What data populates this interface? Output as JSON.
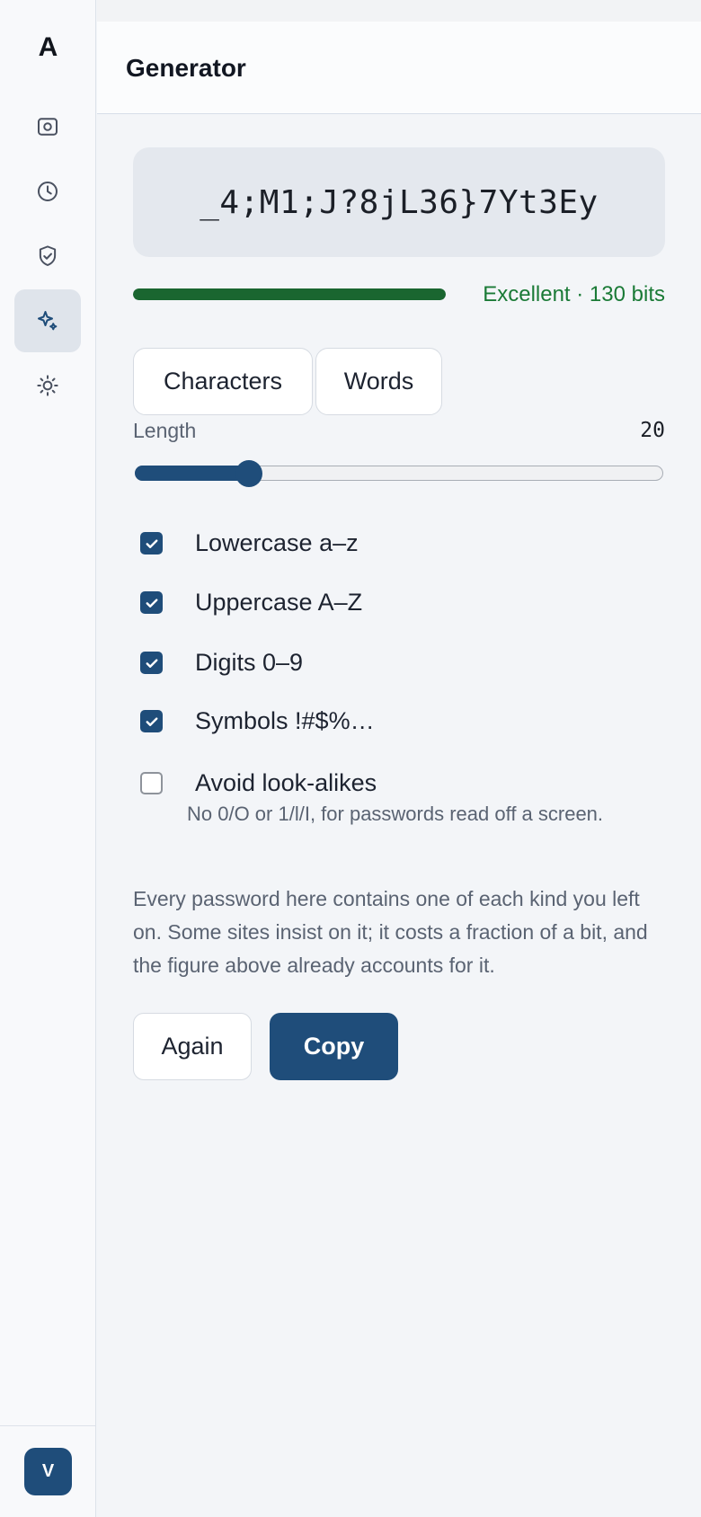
{
  "app": {
    "logo": "A",
    "user_initial": "V"
  },
  "sidebar": {
    "items": [
      {
        "icon": "vault-icon",
        "active": false
      },
      {
        "icon": "clock-icon",
        "active": false
      },
      {
        "icon": "shield-check-icon",
        "active": false
      },
      {
        "icon": "sparkles-icon",
        "active": true
      },
      {
        "icon": "sun-icon",
        "active": false
      }
    ]
  },
  "header": {
    "title": "Generator"
  },
  "generator": {
    "password": "_4;M1;J?8jL36}7Yt3Ey",
    "strength": {
      "label": "Excellent · 130 bits",
      "fill_fraction": 1.0,
      "color": "#1a6630"
    },
    "modes": [
      {
        "label": "Characters",
        "selected": true
      },
      {
        "label": "Words",
        "selected": false
      }
    ],
    "length": {
      "label": "Length",
      "value": "20",
      "min": 8,
      "max": 64
    },
    "options": [
      {
        "label": "Lowercase a–z",
        "checked": true
      },
      {
        "label": "Uppercase A–Z",
        "checked": true
      },
      {
        "label": "Digits 0–9",
        "checked": true
      },
      {
        "label": "Symbols !#$%…",
        "checked": true
      },
      {
        "label": "Avoid look-alikes",
        "checked": false,
        "hint": "No 0/O or 1/l/I, for passwords read off a screen."
      }
    ],
    "info": "Every password here contains one of each kind you left on. Some sites insist on it; it costs a fraction of a bit, and the figure above already accounts for it.",
    "actions": {
      "again_label": "Again",
      "copy_label": "Copy"
    }
  },
  "colors": {
    "accent": "#1f4d7a",
    "success": "#1a7a36"
  }
}
